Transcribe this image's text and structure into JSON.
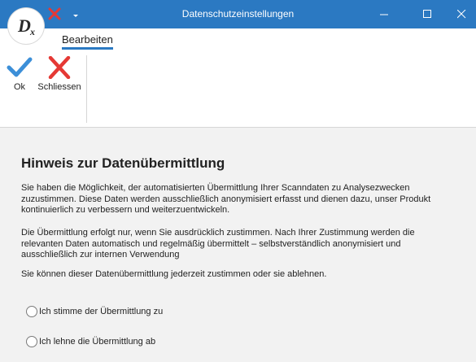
{
  "window": {
    "title": "Datenschutzeinstellungen",
    "accent_color": "#2b79c2"
  },
  "titlebar": {
    "quick_access": [
      {
        "name": "close-red-x-icon",
        "color": "#e53935"
      },
      {
        "name": "chevron-down-icon"
      }
    ],
    "controls": [
      "minimize-icon",
      "maximize-icon",
      "close-icon"
    ]
  },
  "logo": {
    "text": "Dx",
    "icon": "app-logo"
  },
  "ribbon": {
    "active_tab": "Bearbeiten",
    "buttons": [
      {
        "label": "Ok",
        "icon": "checkmark-icon",
        "color": "#3c8fd8"
      },
      {
        "label": "Schliessen",
        "icon": "close-x-icon",
        "color": "#e53935"
      }
    ]
  },
  "content": {
    "heading": "Hinweis zur Datenübermittlung",
    "paragraphs": [
      "Sie haben die Möglichkeit, der automatisierten Übermittlung Ihrer Scanndaten zu Analysezwecken zuzustimmen. Diese Daten werden ausschließlich anonymisiert erfasst und dienen dazu, unser Produkt kontinuierlich zu verbessern und weiterzuentwickeln.",
      "Die Übermittlung erfolgt nur, wenn Sie ausdrücklich zustimmen. Nach Ihrer Zustimmung werden die relevanten Daten automatisch und regelmäßig übermittelt – selbstverständlich anonymisiert und ausschließlich zur internen Verwendung",
      "Sie können dieser Datenübermittlung jederzeit zustimmen oder sie ablehnen."
    ],
    "options": [
      {
        "label": "Ich stimme der Übermittlung zu",
        "selected": false
      },
      {
        "label": "Ich lehne die Übermittlung ab",
        "selected": false
      }
    ]
  }
}
